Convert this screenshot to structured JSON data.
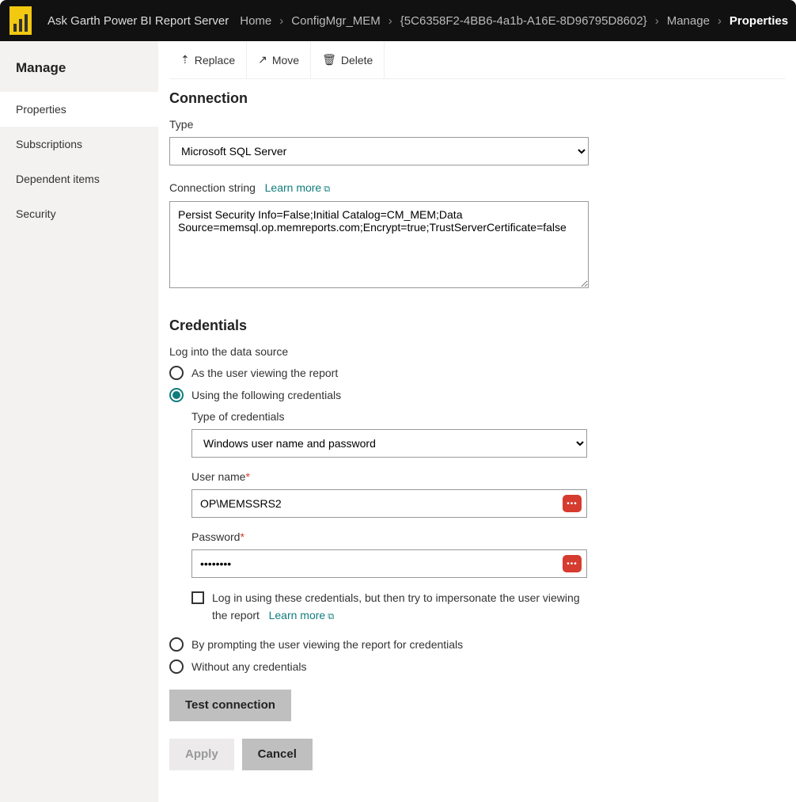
{
  "topbar": {
    "server_name": "Ask Garth Power BI Report Server",
    "breadcrumbs": [
      "Home",
      "ConfigMgr_MEM",
      "{5C6358F2-4BB6-4a1b-A16E-8D96795D8602}",
      "Manage",
      "Properties"
    ]
  },
  "sidebar": {
    "title": "Manage",
    "items": [
      "Properties",
      "Subscriptions",
      "Dependent items",
      "Security"
    ],
    "active_index": 0
  },
  "toolbar": {
    "replace": "Replace",
    "move": "Move",
    "delete": "Delete"
  },
  "connection": {
    "heading": "Connection",
    "type_label": "Type",
    "type_value": "Microsoft SQL Server",
    "conn_string_label": "Connection string",
    "learn_more": "Learn more",
    "conn_string_value": "Persist Security Info=False;Initial Catalog=CM_MEM;Data Source=memsql.op.memreports.com;Encrypt=true;TrustServerCertificate=false"
  },
  "credentials": {
    "heading": "Credentials",
    "intro": "Log into the data source",
    "options": {
      "as_user": "As the user viewing the report",
      "using_following": "Using the following credentials",
      "prompt": "By prompting the user viewing the report for credentials",
      "none": "Without any credentials"
    },
    "selected": "using_following",
    "cred_type_label": "Type of credentials",
    "cred_type_value": "Windows user name and password",
    "username_label": "User name",
    "username_value": "OP\\MEMSSRS2",
    "password_label": "Password",
    "password_value": "••••••••",
    "impersonate_text": "Log in using these credentials, but then try to impersonate the user viewing the report",
    "learn_more": "Learn more"
  },
  "buttons": {
    "test": "Test connection",
    "apply": "Apply",
    "cancel": "Cancel"
  }
}
